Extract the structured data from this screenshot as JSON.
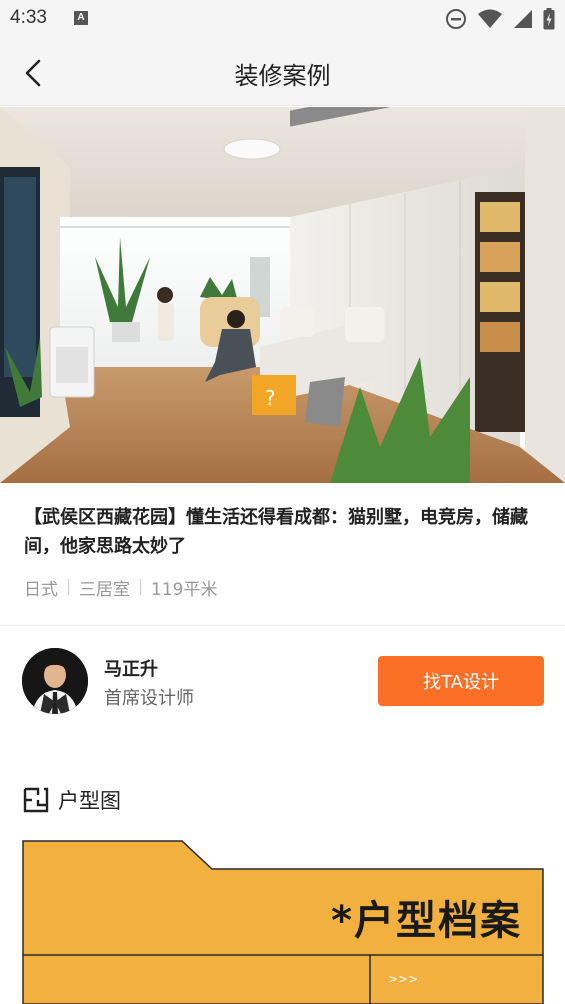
{
  "status_bar": {
    "time": "4:33",
    "notification_badge": "A"
  },
  "nav": {
    "title": "装修案例"
  },
  "article": {
    "title": "【武侯区西藏花园】懂生活还得看成都：猫别墅，电竞房，储藏间，他家思路太妙了",
    "tags": [
      "日式",
      "三居室",
      "119平米"
    ]
  },
  "designer": {
    "name": "马正升",
    "role": "首席设计师",
    "hire_label": "找TA设计"
  },
  "floorplan_section": {
    "title": "户型图",
    "banner_title": "*户型档案",
    "banner_more": ">>>"
  },
  "colors": {
    "accent": "#fb6f26",
    "floorplan_bg": "#f2b13f"
  }
}
